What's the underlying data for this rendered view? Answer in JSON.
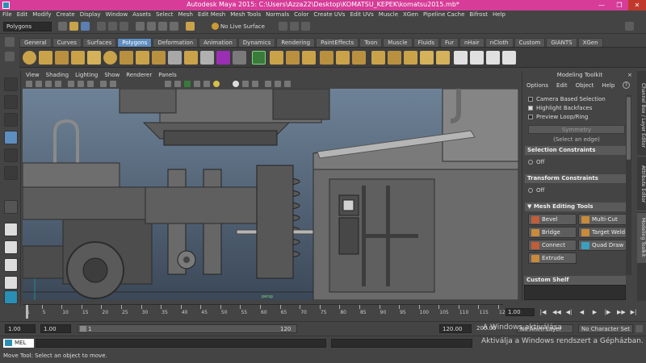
{
  "window": {
    "title": "Autodesk Maya 2015: C:\\Users\\Azza22\\Desktop\\KOMATSU_KEPEK\\komatsu2015.mb*",
    "minimize": "—",
    "maximize": "❐",
    "close": "✕"
  },
  "menu": [
    "File",
    "Edit",
    "Modify",
    "Create",
    "Display",
    "Window",
    "Assets",
    "Select",
    "Mesh",
    "Edit Mesh",
    "Mesh Tools",
    "Normals",
    "Color",
    "Create UVs",
    "Edit UVs",
    "Muscle",
    "XGen",
    "Pipeline Cache",
    "Bifrost",
    "Help"
  ],
  "status_line": {
    "menu_set": "Polygons",
    "live_surface": "No Live Surface"
  },
  "shelf_tabs": [
    "General",
    "Curves",
    "Surfaces",
    "Polygons",
    "Deformation",
    "Animation",
    "Dynamics",
    "Rendering",
    "PaintEffects",
    "Toon",
    "Muscle",
    "Fluids",
    "Fur",
    "nHair",
    "nCloth",
    "Custom",
    "GIANTS",
    "XGen"
  ],
  "active_shelf": "Polygons",
  "viewport_menu": [
    "View",
    "Shading",
    "Lighting",
    "Show",
    "Renderer",
    "Panels"
  ],
  "viewport": {
    "camera": "persp"
  },
  "modeling_toolkit": {
    "title": "Modeling Toolkit",
    "close": "×",
    "menu": [
      "Options",
      "Edit",
      "Object",
      "Help"
    ],
    "help_button": "?",
    "options": [
      {
        "label": "Camera Based Selection",
        "checked": false
      },
      {
        "label": "Highlight Backfaces",
        "checked": true
      },
      {
        "label": "Preview Loop/Ring",
        "checked": false
      }
    ],
    "symmetry_button": "Symmetry",
    "symmetry_hint": "(Select an edge)",
    "selection_constraints": {
      "header": "Selection Constraints",
      "value": "Off"
    },
    "transform_constraints": {
      "header": "Transform Constraints",
      "value": "Off"
    },
    "mesh_editing_tools": {
      "header": "Mesh Editing Tools",
      "arrow": "▼",
      "buttons": [
        "Bevel",
        "Multi-Cut",
        "Bridge",
        "Target Weld",
        "Connect",
        "Quad Draw",
        "Extrude"
      ]
    },
    "custom_shelf": "Custom Shelf"
  },
  "side_tabs": [
    "Channel Box / Layer Editor",
    "Attribute Editor",
    "Modeling Toolkit"
  ],
  "time_slider": {
    "ticks": [
      "1",
      "5",
      "10",
      "15",
      "20",
      "25",
      "30",
      "35",
      "40",
      "45",
      "50",
      "55",
      "60",
      "65",
      "70",
      "75",
      "80",
      "85",
      "90",
      "95",
      "100",
      "105",
      "110",
      "115",
      "120"
    ],
    "current_frame": "1.00",
    "playback": [
      "|◀",
      "◀◀",
      "◀|",
      "◀",
      "▶",
      "|▶",
      "▶▶",
      "▶|"
    ]
  },
  "range_slider": {
    "start_time": "1.00",
    "playback_start": "1.00",
    "range_start_label": "1",
    "range_end_label": "120",
    "playback_end": "120.00",
    "end_time": "200.00",
    "anim_layer": "No Anim Layer",
    "character_set": "No Character Set"
  },
  "command_line": {
    "lang": "MEL"
  },
  "help_line": "Move Tool: Select an object to move.",
  "activation": {
    "line1": "A Windows aktiválása",
    "line2": "Aktiválja a Windows rendszert a Gépházban."
  }
}
